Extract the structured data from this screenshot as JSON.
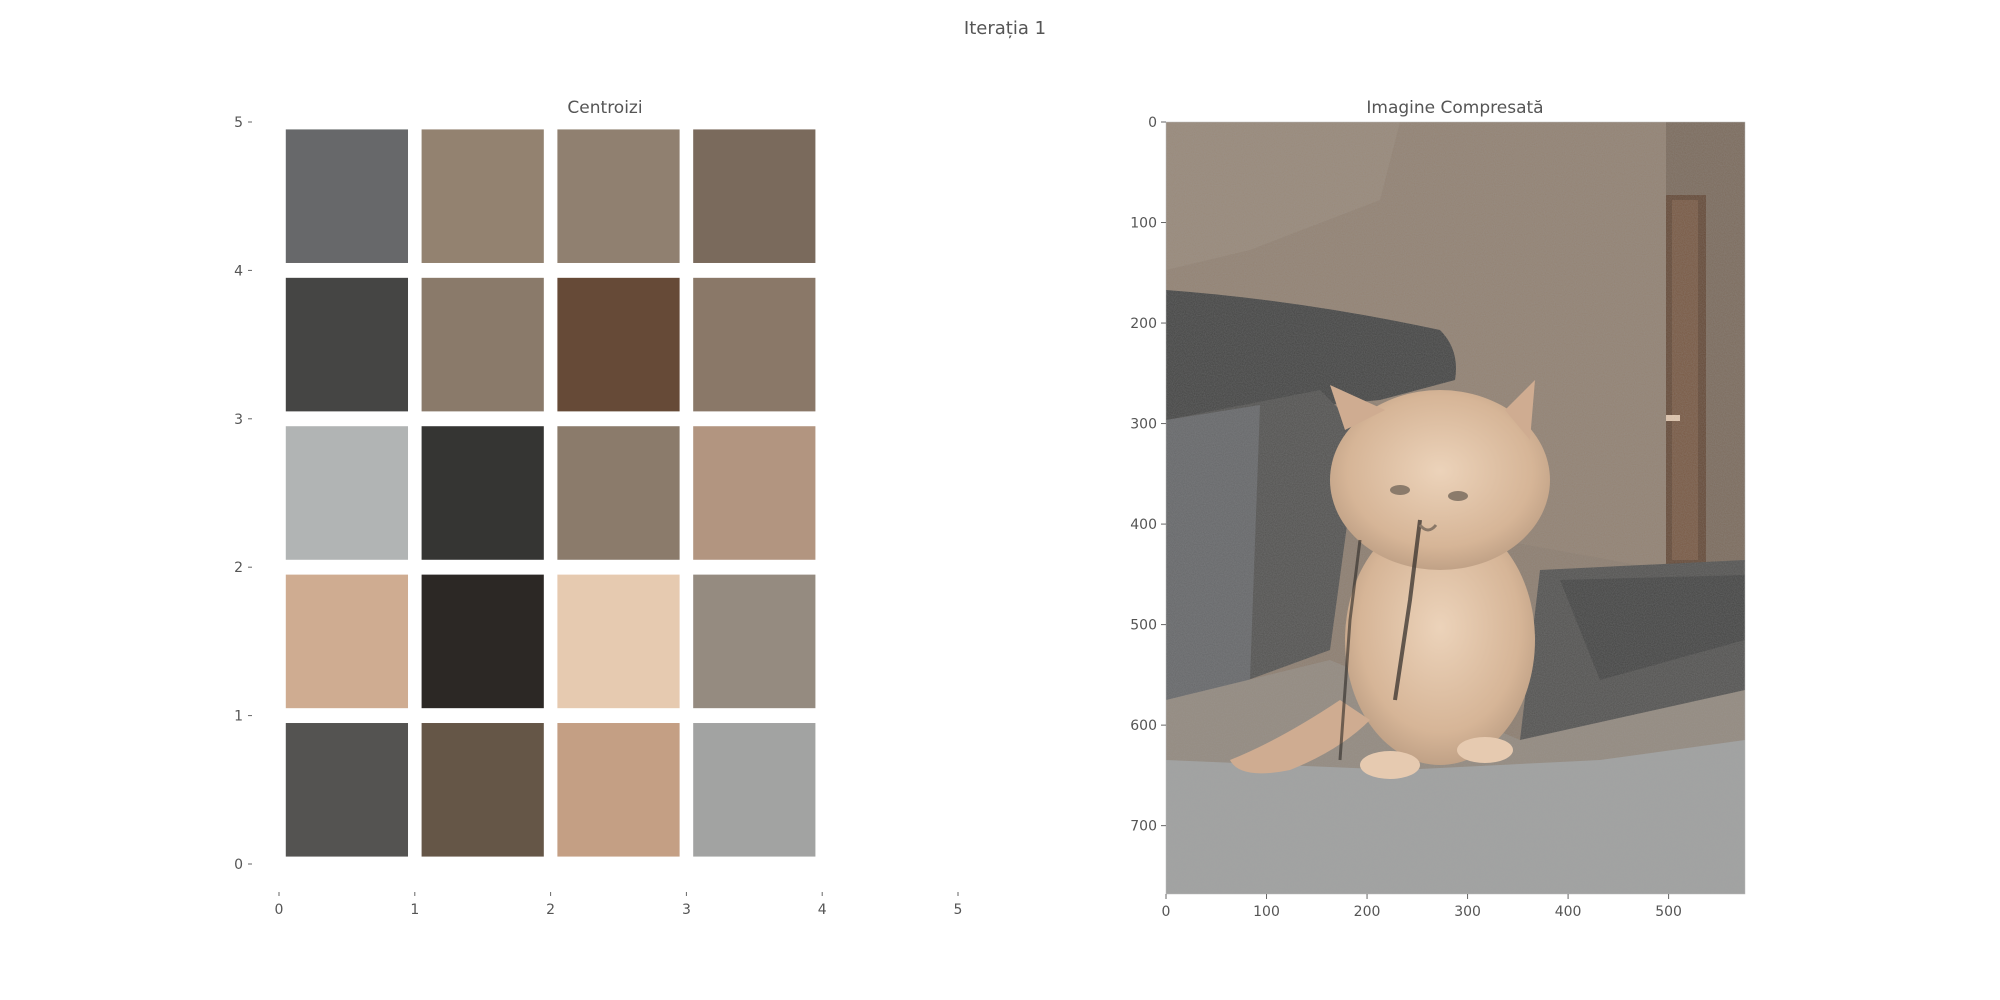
{
  "suptitle": "Iterația 1",
  "chart_data": [
    {
      "type": "heatmap",
      "title": "Centroizi",
      "xlim": [
        0,
        5
      ],
      "ylim": [
        0,
        5
      ],
      "xticks": [
        "0",
        "1",
        "2",
        "3",
        "4",
        "5"
      ],
      "yticks": [
        "0",
        "1",
        "2",
        "3",
        "4",
        "5"
      ],
      "grid": false,
      "cells": [
        {
          "col": 0,
          "row": 0,
          "color": "#545351"
        },
        {
          "col": 1,
          "row": 0,
          "color": "#655647"
        },
        {
          "col": 2,
          "row": 0,
          "color": "#c49f84"
        },
        {
          "col": 3,
          "row": 0,
          "color": "#a2a3a2"
        },
        {
          "col": 0,
          "row": 1,
          "color": "#cfac91"
        },
        {
          "col": 1,
          "row": 1,
          "color": "#2c2825"
        },
        {
          "col": 2,
          "row": 1,
          "color": "#e6cab0"
        },
        {
          "col": 3,
          "row": 1,
          "color": "#958b80"
        },
        {
          "col": 0,
          "row": 2,
          "color": "#b1b4b4"
        },
        {
          "col": 1,
          "row": 2,
          "color": "#353533"
        },
        {
          "col": 2,
          "row": 2,
          "color": "#8b7b6b"
        },
        {
          "col": 3,
          "row": 2,
          "color": "#b29580"
        },
        {
          "col": 0,
          "row": 3,
          "color": "#454544"
        },
        {
          "col": 1,
          "row": 3,
          "color": "#8a7a6a"
        },
        {
          "col": 2,
          "row": 3,
          "color": "#664a37"
        },
        {
          "col": 3,
          "row": 3,
          "color": "#8a7868"
        },
        {
          "col": 0,
          "row": 4,
          "color": "#67686a"
        },
        {
          "col": 1,
          "row": 4,
          "color": "#938270"
        },
        {
          "col": 2,
          "row": 4,
          "color": "#908070"
        },
        {
          "col": 3,
          "row": 4,
          "color": "#7a6a5c"
        }
      ]
    },
    {
      "type": "image",
      "title": "Imagine Compresată",
      "image_subject": "compressed photo of a fluffy cream kitten sitting on a grey couch",
      "xticks": [
        "0",
        "100",
        "200",
        "300",
        "400",
        "500"
      ],
      "yticks": [
        "0",
        "100",
        "200",
        "300",
        "400",
        "500",
        "600",
        "700"
      ],
      "xlim": [
        0,
        576
      ],
      "ylim": [
        768,
        0
      ]
    }
  ]
}
